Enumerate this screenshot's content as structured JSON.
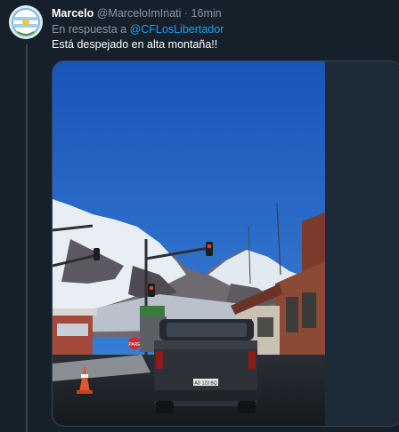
{
  "tweet": {
    "author_name": "Marcelo",
    "author_handle": "@MarceloImInati",
    "separator": "·",
    "time": "16min",
    "reply_prefix": "En respuesta a",
    "reply_mention": "@CFLosLibertador",
    "text": "Está despejado en alta montaña!!"
  },
  "photo": {
    "sign_label": "PARE",
    "plate": "AD 123 BQ"
  },
  "colors": {
    "background": "#15202b",
    "muted_text": "#8899a6",
    "link": "#1da1f2",
    "sky": "#1f5fbf"
  }
}
